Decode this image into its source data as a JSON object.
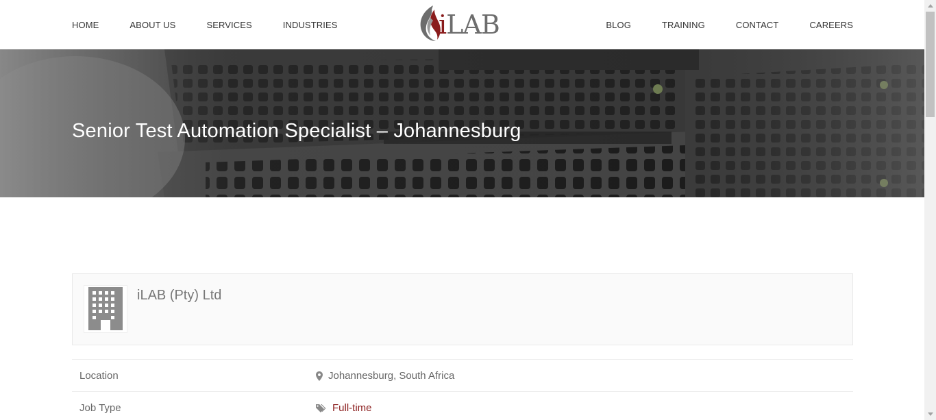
{
  "nav": {
    "left": [
      "HOME",
      "ABOUT US",
      "SERVICES",
      "INDUSTRIES"
    ],
    "right": [
      "BLOG",
      "TRAINING",
      "CONTACT",
      "CAREERS"
    ]
  },
  "logo": {
    "text_i": "i",
    "text_rest": "LAB"
  },
  "hero": {
    "title": "Senior Test Automation Specialist – Johannesburg"
  },
  "company": {
    "name": "iLAB (Pty) Ltd",
    "logo_icon": "building-icon"
  },
  "details": {
    "location_label": "Location",
    "location_value": "Johannesburg, South Africa",
    "job_type_label": "Job Type",
    "job_type_value": "Full-time"
  },
  "colors": {
    "accent": "#8a1c1c",
    "nav_text": "#333333",
    "muted_text": "#666666"
  }
}
